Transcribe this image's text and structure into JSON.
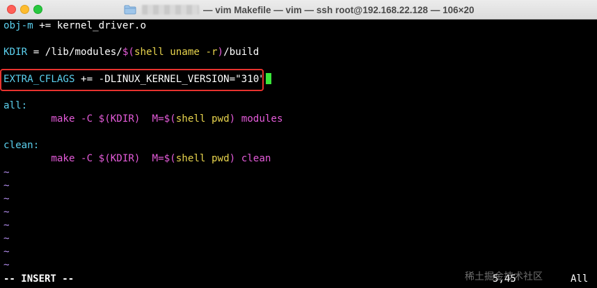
{
  "window": {
    "title": "— vim Makefile — vim — ssh root@192.168.22.128 — 106×20"
  },
  "editor": {
    "lines": {
      "l1": {
        "a": "obj-m",
        "b": " += kernel_driver.o"
      },
      "l3": {
        "a": "KDIR",
        "b": " = /lib/modules/",
        "c": "$(",
        "d": "shell",
        "e": " ",
        "f": "uname -r",
        "g": ")",
        "h": "/build"
      },
      "l5": {
        "a": "EXTRA_CFLAGS",
        "b": " += -DLINUX_KERNEL_VERSION=\"310\""
      },
      "l7": {
        "a": "all:"
      },
      "l8": {
        "a": "        make -C ",
        "b": "$(KDIR)",
        "c": "  M=",
        "d": "$(",
        "e": "shell",
        "f": " ",
        "g": "pwd",
        "h": ")",
        "i": " modules"
      },
      "l10": {
        "a": "clean:"
      },
      "l11": {
        "a": "        make -C ",
        "b": "$(KDIR)",
        "c": "  M=",
        "d": "$(",
        "e": "shell",
        "f": " ",
        "g": "pwd",
        "h": ")",
        "i": " clean"
      }
    },
    "tilde": "~"
  },
  "status": {
    "mode": "-- INSERT --",
    "position": "5,45",
    "scroll": "All"
  },
  "watermark": "稀土掘金技术社区",
  "colors": {
    "cursor": "#39e639",
    "highlight_box": "#e8322e",
    "identifier": "#5bd0ee",
    "command": "#e45bd9",
    "shell_keyword": "#e8d44d",
    "tilde": "#b58ef0"
  }
}
